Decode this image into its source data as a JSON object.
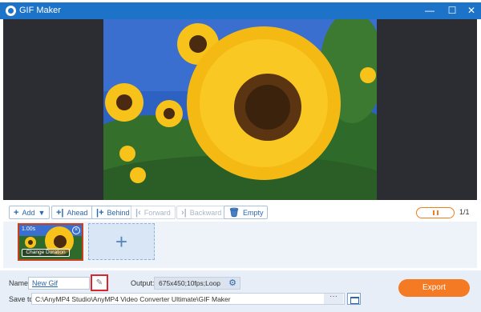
{
  "window": {
    "title": "GIF Maker",
    "controls": {
      "minimize": "—",
      "maximize": "☐",
      "close": "✕"
    },
    "accent": "#1d73c8"
  },
  "toolbar": {
    "add": "Add",
    "ahead": "Ahead",
    "behind": "Behind",
    "forward": "Forward",
    "backward": "Backward",
    "empty": "Empty",
    "page": "1/1"
  },
  "clip": {
    "duration": "1.00s",
    "change_duration": "Change Duration"
  },
  "bottom": {
    "name_label": "Name:",
    "name_value": "New Gif",
    "output_label": "Output:",
    "output_value": "675x450;10fps;Loop",
    "save_label": "Save to:",
    "save_path": "C:\\AnyMP4 Studio\\AnyMP4 Video Converter Ultimate\\GIF Maker",
    "browse": "···",
    "export": "Export",
    "export_color": "#f47a23"
  }
}
